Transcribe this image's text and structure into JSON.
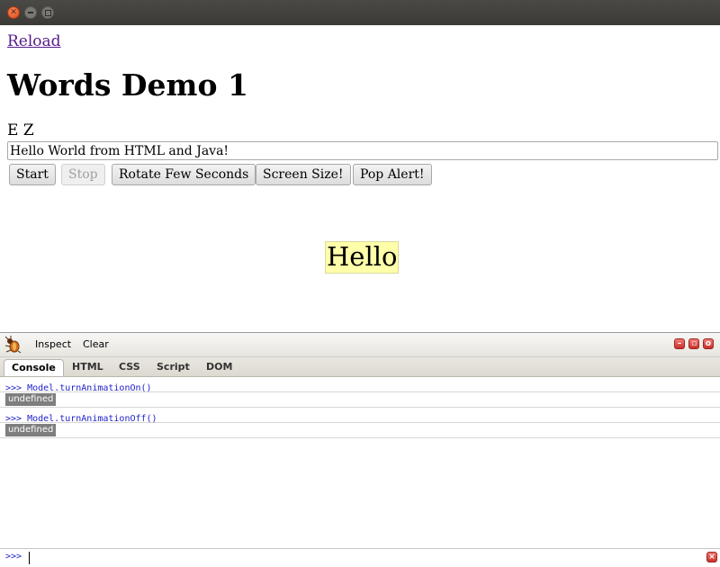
{
  "window": {
    "close_glyph": "✕"
  },
  "page": {
    "reload_label": "Reload",
    "title": "Words Demo 1",
    "letters": "E Z",
    "input_value": "Hello World from HTML and Java!",
    "buttons": {
      "start": "Start",
      "stop": "Stop",
      "rotate": "Rotate Few Seconds",
      "screen_size": "Screen Size!",
      "pop_alert": "Pop Alert!"
    },
    "word": "Hello"
  },
  "firebug": {
    "toolbar": {
      "inspect": "Inspect",
      "clear": "Clear"
    },
    "tabs": [
      "Console",
      "HTML",
      "CSS",
      "Script",
      "DOM"
    ],
    "active_tab": "Console",
    "log": [
      {
        "command": ">>> Model.turnAnimationOn()",
        "result": "undefined"
      },
      {
        "command": ">>> Model.turnAnimationOff()",
        "result": "undefined"
      }
    ],
    "prompt": ">>>"
  },
  "colors": {
    "link_visited": "#551a8b",
    "hello_background": "#ffffaa",
    "console_command": "#1c1fc7",
    "titlebar": "#3b3a36"
  },
  "icons": [
    "close-icon",
    "minimize-icon",
    "maximize-icon",
    "firebug-icon",
    "panel-minimize-icon",
    "panel-detach-icon",
    "panel-close-icon",
    "commandline-close-icon"
  ]
}
